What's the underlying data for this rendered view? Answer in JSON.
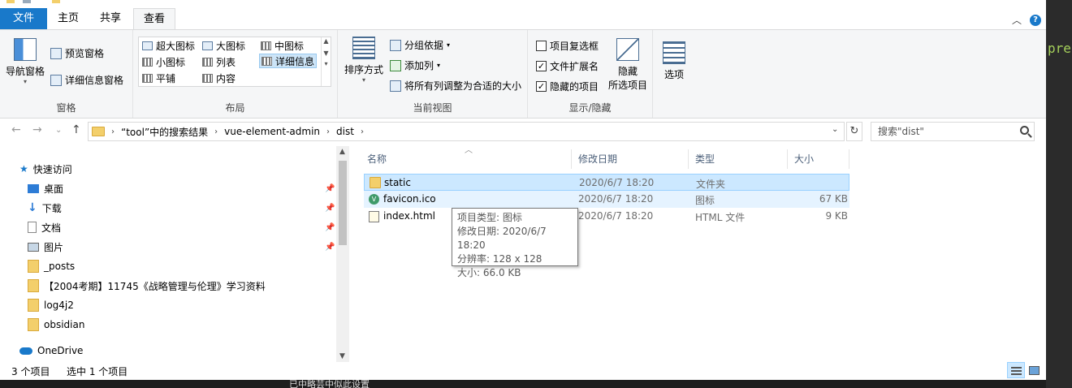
{
  "ribbon": {
    "tabs": {
      "file": "文件",
      "home": "主页",
      "share": "共享",
      "view": "查看"
    },
    "panes": {
      "nav_pane": "导航窗格",
      "preview_pane": "预览窗格",
      "details_pane": "详细信息窗格",
      "label": "窗格"
    },
    "layout": {
      "xl_icons": "超大图标",
      "large_icons": "大图标",
      "medium_icons": "中图标",
      "small_icons": "小图标",
      "list": "列表",
      "details": "详细信息",
      "tiles": "平铺",
      "content": "内容",
      "label": "布局"
    },
    "current_view": {
      "sort_by": "排序方式",
      "group_by": "分组依据",
      "add_columns": "添加列",
      "fit_columns": "将所有列调整为合适的大小",
      "label": "当前视图"
    },
    "show_hide": {
      "item_checkboxes": "项目复选框",
      "file_extensions": "文件扩展名",
      "hidden_items": "隐藏的项目",
      "hide_selected_line1": "隐藏",
      "hide_selected_line2": "所选项目",
      "label": "显示/隐藏",
      "item_checkboxes_checked": false,
      "file_extensions_checked": true,
      "hidden_items_checked": true
    },
    "options": "选项"
  },
  "address": {
    "crumbs": [
      "“tool”中的搜索结果",
      "vue-element-admin",
      "dist"
    ],
    "search_placeholder": "搜索\"dist\""
  },
  "nav": {
    "quick_access": "快速访问",
    "items": [
      "桌面",
      "下载",
      "文档",
      "图片",
      "_posts",
      "【2004考期】11745《战略管理与伦理》学习资料",
      "log4j2",
      "obsidian"
    ],
    "onedrive": "OneDrive"
  },
  "files": {
    "columns": {
      "name": "名称",
      "modified": "修改日期",
      "type": "类型",
      "size": "大小"
    },
    "rows": [
      {
        "name": "static",
        "modified": "2020/6/7 18:20",
        "type": "文件夹",
        "size": ""
      },
      {
        "name": "favicon.ico",
        "modified": "2020/6/7 18:20",
        "type": "图标",
        "size": "67 KB"
      },
      {
        "name": "index.html",
        "modified": "2020/6/7 18:20",
        "type": "HTML 文件",
        "size": "9 KB"
      }
    ]
  },
  "tooltip": {
    "type": "项目类型: 图标",
    "modified": "修改日期: 2020/6/7 18:20",
    "resolution": "分辨率: 128 x 128",
    "size": "大小: 66.0 KB"
  },
  "status": {
    "count": "3 个项目",
    "selected": "选中 1 个项目"
  },
  "background": {
    "editor_peek": "pre",
    "bottom_peek": "已中略芸中似此设置"
  },
  "colors": {
    "accent": "#1979ca",
    "selection": "#cce8ff",
    "folder": "#f3cf6b"
  }
}
